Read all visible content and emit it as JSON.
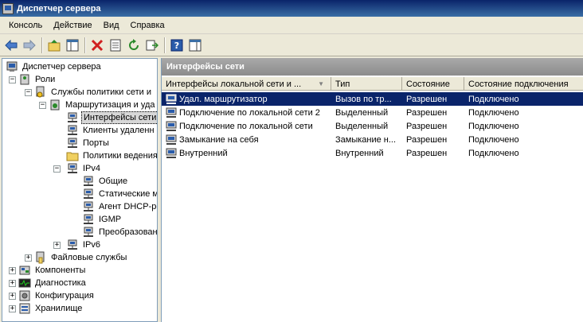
{
  "window": {
    "title": "Диспетчер сервера"
  },
  "menu": [
    "Консоль",
    "Действие",
    "Вид",
    "Справка"
  ],
  "toolbar": {
    "icons": [
      "back-arrow-icon",
      "forward-arrow-icon",
      "up-folder-icon",
      "show-hide-tree-icon",
      "delete-icon",
      "properties-icon",
      "refresh-icon",
      "export-list-icon",
      "help-icon",
      "show-hide-action-pane-icon"
    ]
  },
  "tree": {
    "root": "Диспетчер сервера",
    "roles": "Роли",
    "npas": "Службы политики сети и",
    "rras": "Маршрутизация и уда",
    "interfaces": "Интерфейсы сети",
    "clients": "Клиенты удаленн",
    "ports": "Порты",
    "logging": "Политики ведения",
    "ipv4": "IPv4",
    "general": "Общие",
    "static_routes": "Статические м",
    "dhcp_agent": "Агент DHCP-ре",
    "igmp": "IGMP",
    "nat": "Преобразовани",
    "ipv6": "IPv6",
    "file_services": "Файловые службы",
    "features": "Компоненты",
    "diagnostics": "Диагностика",
    "configuration": "Конфигурация",
    "storage": "Хранилище"
  },
  "right_pane": {
    "title": "Интерфейсы сети",
    "columns": [
      "Интерфейсы локальной сети и ...",
      "Тип",
      "Состояние",
      "Состояние подключения"
    ],
    "rows": [
      {
        "name": "Удал. маршрутизатор",
        "type": "Вызов по тр...",
        "status": "Разрешен",
        "connection": "Подключено"
      },
      {
        "name": "Подключение по локальной сети 2",
        "type": "Выделенный",
        "status": "Разрешен",
        "connection": "Подключено"
      },
      {
        "name": "Подключение по локальной сети",
        "type": "Выделенный",
        "status": "Разрешен",
        "connection": "Подключено"
      },
      {
        "name": "Замыкание на себя",
        "type": "Замыкание н...",
        "status": "Разрешен",
        "connection": "Подключено"
      },
      {
        "name": "Внутренний",
        "type": "Внутренний",
        "status": "Разрешен",
        "connection": "Подключено"
      }
    ]
  },
  "colors": {
    "selection": "#0a246a",
    "title_bar": "#0a246a",
    "pane_header": "#8c8c8c"
  }
}
